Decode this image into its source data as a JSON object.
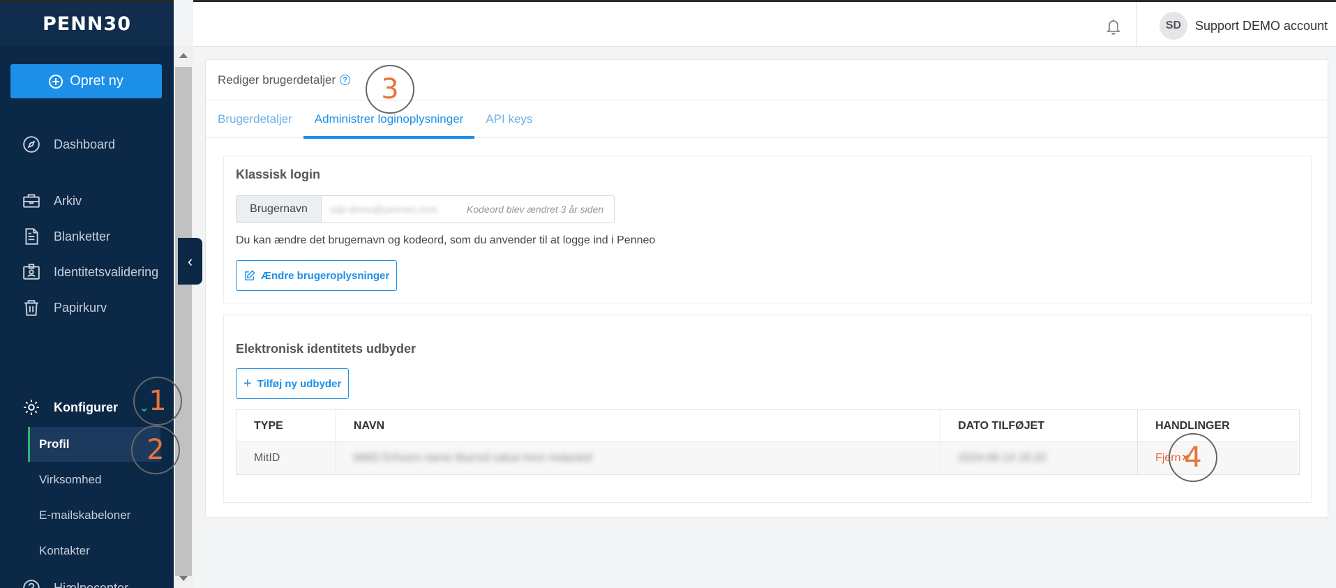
{
  "app": {
    "logo": "PENN30"
  },
  "sidebar": {
    "create_label": "Opret ny",
    "items": [
      {
        "label": "Dashboard",
        "icon": "compass-icon"
      },
      {
        "label": "Arkiv",
        "icon": "briefcase-icon"
      },
      {
        "label": "Blanketter",
        "icon": "document-icon"
      },
      {
        "label": "Identitetsvalidering",
        "icon": "id-card-icon"
      },
      {
        "label": "Papirkurv",
        "icon": "trash-icon"
      }
    ],
    "configure": {
      "label": "Konfigurer",
      "icon": "gear-icon"
    },
    "sub_items": [
      {
        "label": "Profil",
        "active": true
      },
      {
        "label": "Virksomhed"
      },
      {
        "label": "E-mailskabeloner"
      },
      {
        "label": "Kontakter"
      }
    ],
    "help_label": "Hjælpecenter"
  },
  "topbar": {
    "avatar_initials": "SD",
    "account_name": "Support DEMO account"
  },
  "page": {
    "header": "Rediger brugerdetaljer",
    "tabs": [
      {
        "label": "Brugerdetaljer"
      },
      {
        "label": "Administrer loginoplysninger",
        "active": true
      },
      {
        "label": "API keys"
      }
    ],
    "classic_login": {
      "title": "Klassisk login",
      "username_label": "Brugernavn",
      "username_value": "sdp-demo@penneo.com",
      "password_changed": "Kodeord blev ændret 3 år siden",
      "help_text": "Du kan ændre det brugernavn og kodeord, som du anvender til at logge ind i Penneo",
      "change_button": "Ændre brugeroplysninger"
    },
    "eid": {
      "title": "Elektronisk identitets udbyder",
      "add_button": "Tilføj ny udbyder",
      "columns": [
        "TYPE",
        "NAVN",
        "DATO TILFØJET",
        "HANDLINGER"
      ],
      "rows": [
        {
          "type": "MitID",
          "name": "MitID Erhverv name blurred value here redacted",
          "date": "2024-06-14 16:20",
          "action": "Fjern"
        }
      ]
    }
  },
  "annotations": [
    "1",
    "2",
    "3",
    "4"
  ],
  "colors": {
    "sidebar": "#0c2847",
    "accent": "#1c8fe8",
    "active_marker": "#2bb673",
    "danger": "#e8622c"
  }
}
